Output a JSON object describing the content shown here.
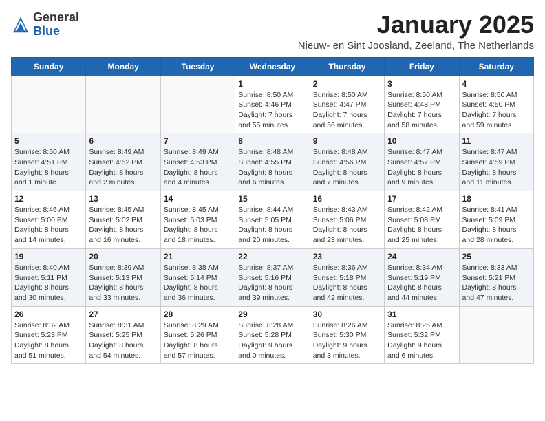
{
  "header": {
    "logo_general": "General",
    "logo_blue": "Blue",
    "month_title": "January 2025",
    "location": "Nieuw- en Sint Joosland, Zeeland, The Netherlands"
  },
  "weekdays": [
    "Sunday",
    "Monday",
    "Tuesday",
    "Wednesday",
    "Thursday",
    "Friday",
    "Saturday"
  ],
  "weeks": [
    [
      {
        "day": "",
        "info": ""
      },
      {
        "day": "",
        "info": ""
      },
      {
        "day": "",
        "info": ""
      },
      {
        "day": "1",
        "info": "Sunrise: 8:50 AM\nSunset: 4:46 PM\nDaylight: 7 hours\nand 55 minutes."
      },
      {
        "day": "2",
        "info": "Sunrise: 8:50 AM\nSunset: 4:47 PM\nDaylight: 7 hours\nand 56 minutes."
      },
      {
        "day": "3",
        "info": "Sunrise: 8:50 AM\nSunset: 4:48 PM\nDaylight: 7 hours\nand 58 minutes."
      },
      {
        "day": "4",
        "info": "Sunrise: 8:50 AM\nSunset: 4:50 PM\nDaylight: 7 hours\nand 59 minutes."
      }
    ],
    [
      {
        "day": "5",
        "info": "Sunrise: 8:50 AM\nSunset: 4:51 PM\nDaylight: 8 hours\nand 1 minute."
      },
      {
        "day": "6",
        "info": "Sunrise: 8:49 AM\nSunset: 4:52 PM\nDaylight: 8 hours\nand 2 minutes."
      },
      {
        "day": "7",
        "info": "Sunrise: 8:49 AM\nSunset: 4:53 PM\nDaylight: 8 hours\nand 4 minutes."
      },
      {
        "day": "8",
        "info": "Sunrise: 8:48 AM\nSunset: 4:55 PM\nDaylight: 8 hours\nand 6 minutes."
      },
      {
        "day": "9",
        "info": "Sunrise: 8:48 AM\nSunset: 4:56 PM\nDaylight: 8 hours\nand 7 minutes."
      },
      {
        "day": "10",
        "info": "Sunrise: 8:47 AM\nSunset: 4:57 PM\nDaylight: 8 hours\nand 9 minutes."
      },
      {
        "day": "11",
        "info": "Sunrise: 8:47 AM\nSunset: 4:59 PM\nDaylight: 8 hours\nand 11 minutes."
      }
    ],
    [
      {
        "day": "12",
        "info": "Sunrise: 8:46 AM\nSunset: 5:00 PM\nDaylight: 8 hours\nand 14 minutes."
      },
      {
        "day": "13",
        "info": "Sunrise: 8:45 AM\nSunset: 5:02 PM\nDaylight: 8 hours\nand 16 minutes."
      },
      {
        "day": "14",
        "info": "Sunrise: 8:45 AM\nSunset: 5:03 PM\nDaylight: 8 hours\nand 18 minutes."
      },
      {
        "day": "15",
        "info": "Sunrise: 8:44 AM\nSunset: 5:05 PM\nDaylight: 8 hours\nand 20 minutes."
      },
      {
        "day": "16",
        "info": "Sunrise: 8:43 AM\nSunset: 5:06 PM\nDaylight: 8 hours\nand 23 minutes."
      },
      {
        "day": "17",
        "info": "Sunrise: 8:42 AM\nSunset: 5:08 PM\nDaylight: 8 hours\nand 25 minutes."
      },
      {
        "day": "18",
        "info": "Sunrise: 8:41 AM\nSunset: 5:09 PM\nDaylight: 8 hours\nand 28 minutes."
      }
    ],
    [
      {
        "day": "19",
        "info": "Sunrise: 8:40 AM\nSunset: 5:11 PM\nDaylight: 8 hours\nand 30 minutes."
      },
      {
        "day": "20",
        "info": "Sunrise: 8:39 AM\nSunset: 5:13 PM\nDaylight: 8 hours\nand 33 minutes."
      },
      {
        "day": "21",
        "info": "Sunrise: 8:38 AM\nSunset: 5:14 PM\nDaylight: 8 hours\nand 36 minutes."
      },
      {
        "day": "22",
        "info": "Sunrise: 8:37 AM\nSunset: 5:16 PM\nDaylight: 8 hours\nand 39 minutes."
      },
      {
        "day": "23",
        "info": "Sunrise: 8:36 AM\nSunset: 5:18 PM\nDaylight: 8 hours\nand 42 minutes."
      },
      {
        "day": "24",
        "info": "Sunrise: 8:34 AM\nSunset: 5:19 PM\nDaylight: 8 hours\nand 44 minutes."
      },
      {
        "day": "25",
        "info": "Sunrise: 8:33 AM\nSunset: 5:21 PM\nDaylight: 8 hours\nand 47 minutes."
      }
    ],
    [
      {
        "day": "26",
        "info": "Sunrise: 8:32 AM\nSunset: 5:23 PM\nDaylight: 8 hours\nand 51 minutes."
      },
      {
        "day": "27",
        "info": "Sunrise: 8:31 AM\nSunset: 5:25 PM\nDaylight: 8 hours\nand 54 minutes."
      },
      {
        "day": "28",
        "info": "Sunrise: 8:29 AM\nSunset: 5:26 PM\nDaylight: 8 hours\nand 57 minutes."
      },
      {
        "day": "29",
        "info": "Sunrise: 8:28 AM\nSunset: 5:28 PM\nDaylight: 9 hours\nand 0 minutes."
      },
      {
        "day": "30",
        "info": "Sunrise: 8:26 AM\nSunset: 5:30 PM\nDaylight: 9 hours\nand 3 minutes."
      },
      {
        "day": "31",
        "info": "Sunrise: 8:25 AM\nSunset: 5:32 PM\nDaylight: 9 hours\nand 6 minutes."
      },
      {
        "day": "",
        "info": ""
      }
    ]
  ]
}
